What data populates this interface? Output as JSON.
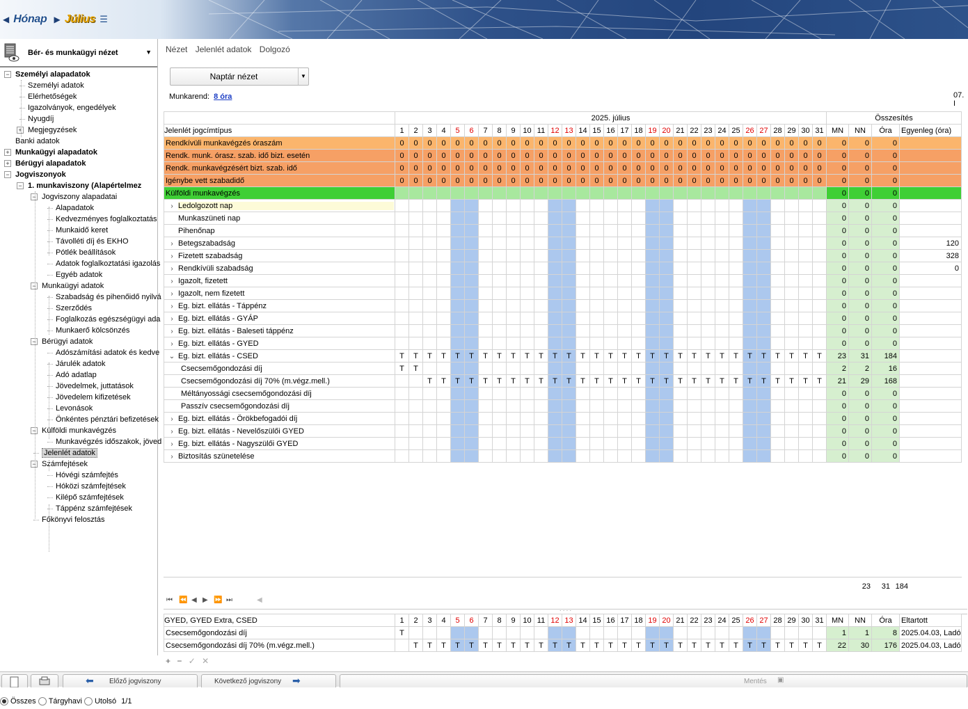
{
  "nav": {
    "month_label": "Hónap",
    "month_value": "Július"
  },
  "left_panel": {
    "title": "Bér- és munkaügyi nézet",
    "tree": [
      {
        "label": "Személyi alapadatok",
        "level": 0,
        "bold": true,
        "box": "minus"
      },
      {
        "label": "Személyi adatok",
        "level": 1
      },
      {
        "label": "Elérhetőségek",
        "level": 1
      },
      {
        "label": "Igazolványok, engedélyek",
        "level": 1
      },
      {
        "label": "Nyugdíj",
        "level": 1
      },
      {
        "label": "Megjegyzések",
        "level": 1,
        "box": "plus"
      },
      {
        "label": "Banki adatok",
        "level": 0
      },
      {
        "label": "Munkaügyi alapadatok",
        "level": 0,
        "bold": true,
        "box": "plus"
      },
      {
        "label": "Bérügyi alapadatok",
        "level": 0,
        "bold": true,
        "box": "plus"
      },
      {
        "label": "Jogviszonyok",
        "level": 0,
        "bold": true,
        "box": "minus"
      },
      {
        "label": "1. munkaviszony  (Alapértelmez",
        "level": 1,
        "bold": true,
        "box": "minus"
      },
      {
        "label": "Jogviszony alapadatai",
        "level": 2,
        "box": "minus"
      },
      {
        "label": "Alapadatok",
        "level": 3
      },
      {
        "label": "Kedvezményes foglalkoztatás",
        "level": 3
      },
      {
        "label": "Munkaidő keret",
        "level": 3
      },
      {
        "label": "Távolléti díj és EKHO",
        "level": 3
      },
      {
        "label": "Pótlék beállítások",
        "level": 3
      },
      {
        "label": "Adatok foglalkoztatási igazolás",
        "level": 3
      },
      {
        "label": "Egyéb adatok",
        "level": 3
      },
      {
        "label": "Munkaügyi adatok",
        "level": 2,
        "box": "minus"
      },
      {
        "label": "Szabadság és pihenőidő nyilvá",
        "level": 3
      },
      {
        "label": "Szerződés",
        "level": 3
      },
      {
        "label": "Foglalkozás egészségügyi ada",
        "level": 3
      },
      {
        "label": "Munkaerő kölcsönzés",
        "level": 3
      },
      {
        "label": "Bérügyi adatok",
        "level": 2,
        "box": "minus"
      },
      {
        "label": "Adószámítási adatok és kedve",
        "level": 3
      },
      {
        "label": "Járulék adatok",
        "level": 3
      },
      {
        "label": "Adó adatlap",
        "level": 3
      },
      {
        "label": "Jövedelmek, juttatások",
        "level": 3
      },
      {
        "label": "Jövedelem kifizetések",
        "level": 3
      },
      {
        "label": "Levonások",
        "level": 3
      },
      {
        "label": "Önkéntes pénztári befizetések",
        "level": 3
      },
      {
        "label": "Külföldi munkavégzés",
        "level": 2,
        "box": "minus"
      },
      {
        "label": "Munkavégzés időszakok, jöved",
        "level": 3
      },
      {
        "label": "Jelenlét adatok",
        "level": 2,
        "selected": true
      },
      {
        "label": "Számfejtések",
        "level": 2,
        "box": "minus"
      },
      {
        "label": "Hóvégi számfejtés",
        "level": 3
      },
      {
        "label": "Hóközi számfejtések",
        "level": 3
      },
      {
        "label": "Kilépő számfejtések",
        "level": 3
      },
      {
        "label": "Táppénz számfejtések",
        "level": 3
      },
      {
        "label": "Főkönyvi felosztás",
        "level": 2
      }
    ],
    "footer": {
      "all": "Összes",
      "month": "Tárgyhavi",
      "last": "Utolsó",
      "page": "1/1"
    }
  },
  "menu": [
    "Nézet",
    "Jelenlét adatok",
    "Dolgozó"
  ],
  "view_select": "Naptár nézet",
  "work_schedule": {
    "label": "Munkarend:",
    "value": "8 óra"
  },
  "date_cut": "07. I",
  "calendar": {
    "month_title": "2025. július",
    "summary_title": "Összesítés",
    "type_header": "Jelenlét jogcímtípus",
    "days": [
      1,
      2,
      3,
      4,
      5,
      6,
      7,
      8,
      9,
      10,
      11,
      12,
      13,
      14,
      15,
      16,
      17,
      18,
      19,
      20,
      21,
      22,
      23,
      24,
      25,
      26,
      27,
      28,
      29,
      30,
      31
    ],
    "weekend_days": [
      5,
      6,
      12,
      13,
      19,
      20,
      26,
      27
    ],
    "sum_headers": [
      "MN",
      "NN",
      "Óra",
      "Egyenleg (óra)"
    ],
    "top_rows": [
      {
        "label": "Rendkívüli munkavégzés óraszám",
        "color": "orange-l",
        "cell": "0",
        "sums": [
          "0",
          "0",
          "0",
          ""
        ]
      },
      {
        "label": "Rendk. munk. órasz. szab. idő bizt. esetén",
        "color": "orange-d",
        "cell": "0",
        "sums": [
          "0",
          "0",
          "0",
          ""
        ]
      },
      {
        "label": "Rendk. munkavégzésért bizt. szab. idő",
        "color": "orange-d",
        "cell": "0",
        "sums": [
          "0",
          "0",
          "0",
          ""
        ]
      },
      {
        "label": "Igénybe vett szabadidő",
        "color": "orange-d",
        "cell": "0",
        "sums": [
          "0",
          "0",
          "0",
          ""
        ]
      },
      {
        "label": "Külföldi munkavégzés",
        "color": "green",
        "cell": "",
        "sums": [
          "0",
          "0",
          "0",
          ""
        ]
      }
    ],
    "rows": [
      {
        "label": "Ledolgozott nap",
        "exp": "›",
        "cells": "",
        "sums": [
          "0",
          "0",
          "0",
          ""
        ],
        "yellow": true
      },
      {
        "label": "Munkaszüneti nap",
        "exp": "",
        "cells": "",
        "sums": [
          "0",
          "0",
          "0",
          ""
        ]
      },
      {
        "label": "Pihenőnap",
        "exp": "",
        "cells": "",
        "sums": [
          "0",
          "0",
          "0",
          ""
        ]
      },
      {
        "label": "Betegszabadság",
        "exp": "›",
        "cells": "",
        "sums": [
          "0",
          "0",
          "0",
          "120"
        ]
      },
      {
        "label": "Fizetett szabadság",
        "exp": "›",
        "cells": "",
        "sums": [
          "0",
          "0",
          "0",
          "328"
        ]
      },
      {
        "label": "Rendkívüli szabadság",
        "exp": "›",
        "cells": "",
        "sums": [
          "0",
          "0",
          "0",
          "0"
        ]
      },
      {
        "label": "Igazolt, fizetett",
        "exp": "›",
        "cells": "",
        "sums": [
          "0",
          "0",
          "0",
          ""
        ]
      },
      {
        "label": "Igazolt, nem fizetett",
        "exp": "›",
        "cells": "",
        "sums": [
          "0",
          "0",
          "0",
          ""
        ]
      },
      {
        "label": "Eg. bizt. ellátás - Táppénz",
        "exp": "›",
        "cells": "",
        "sums": [
          "0",
          "0",
          "0",
          ""
        ]
      },
      {
        "label": "Eg. bizt. ellátás - GYÁP",
        "exp": "›",
        "cells": "",
        "sums": [
          "0",
          "0",
          "0",
          ""
        ]
      },
      {
        "label": "Eg. bizt. ellátás - Baleseti táppénz",
        "exp": "›",
        "cells": "",
        "sums": [
          "0",
          "0",
          "0",
          ""
        ]
      },
      {
        "label": "Eg. bizt. ellátás - GYED",
        "exp": "›",
        "cells": "",
        "sums": [
          "0",
          "0",
          "0",
          ""
        ]
      },
      {
        "label": "Eg. bizt. ellátás - CSED",
        "exp": "⌄",
        "cells": "all",
        "sums": [
          "23",
          "31",
          "184",
          ""
        ]
      },
      {
        "label": "Csecsemőgondozási díj",
        "exp": "",
        "sub": true,
        "cells": "first2",
        "sums": [
          "2",
          "2",
          "16",
          ""
        ]
      },
      {
        "label": "Csecsemőgondozási díj 70% (m.végz.mell.)",
        "exp": "",
        "sub": true,
        "cells": "from3",
        "sums": [
          "21",
          "29",
          "168",
          ""
        ]
      },
      {
        "label": "Méltányossági csecsemőgondozási díj",
        "exp": "",
        "sub": true,
        "cells": "",
        "sums": [
          "0",
          "0",
          "0",
          ""
        ]
      },
      {
        "label": "Passzív csecsemőgondozási díj",
        "exp": "",
        "sub": true,
        "cells": "",
        "sums": [
          "0",
          "0",
          "0",
          ""
        ]
      },
      {
        "label": "Eg. bizt. ellátás - Örökbefogadói díj",
        "exp": "›",
        "cells": "",
        "sums": [
          "0",
          "0",
          "0",
          ""
        ]
      },
      {
        "label": "Eg. bizt. ellátás - Nevelőszülői GYED",
        "exp": "›",
        "cells": "",
        "sums": [
          "0",
          "0",
          "0",
          ""
        ]
      },
      {
        "label": "Eg. bizt. ellátás - Nagyszülői GYED",
        "exp": "›",
        "cells": "",
        "sums": [
          "0",
          "0",
          "0",
          ""
        ]
      },
      {
        "label": "Biztosítás szünetelése",
        "exp": "›",
        "cells": "",
        "sums": [
          "0",
          "0",
          "0",
          ""
        ]
      }
    ],
    "mark": "T",
    "totals": [
      "23",
      "31",
      "184"
    ]
  },
  "lower": {
    "type_header": "GYED, GYED Extra, CSED",
    "sum_headers": [
      "MN",
      "NN",
      "Óra",
      "Eltartott"
    ],
    "rows": [
      {
        "label": "Csecsemőgondozási díj",
        "cells": "first1",
        "sums": [
          "1",
          "1",
          "8",
          "2025.04.03, Ladó"
        ]
      },
      {
        "label": "Csecsemőgondozási díj 70% (m.végz.mell.)",
        "cells": "from2",
        "sums": [
          "22",
          "30",
          "176",
          "2025.04.03, Ladó"
        ]
      }
    ]
  },
  "toolbar": {
    "prev": "Előző jogviszony",
    "next": "Következő jogviszony",
    "save": "Mentés"
  }
}
